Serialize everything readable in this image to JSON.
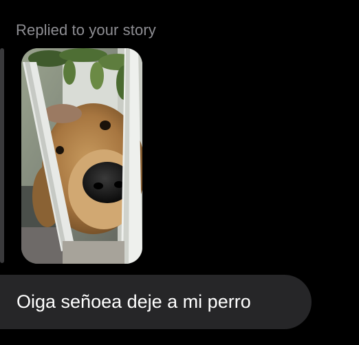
{
  "reply_context": {
    "label": "Replied to your story"
  },
  "story": {
    "thumbnail_subject": "dog-peeking-through-fence-photo"
  },
  "message": {
    "text": "Oiga señoea deje a mi perro"
  },
  "colors": {
    "background": "#000000",
    "bubble": "#262628",
    "secondary_text": "#8e8e93",
    "primary_text": "#ffffff",
    "quote_bar": "#3a3a3c"
  }
}
